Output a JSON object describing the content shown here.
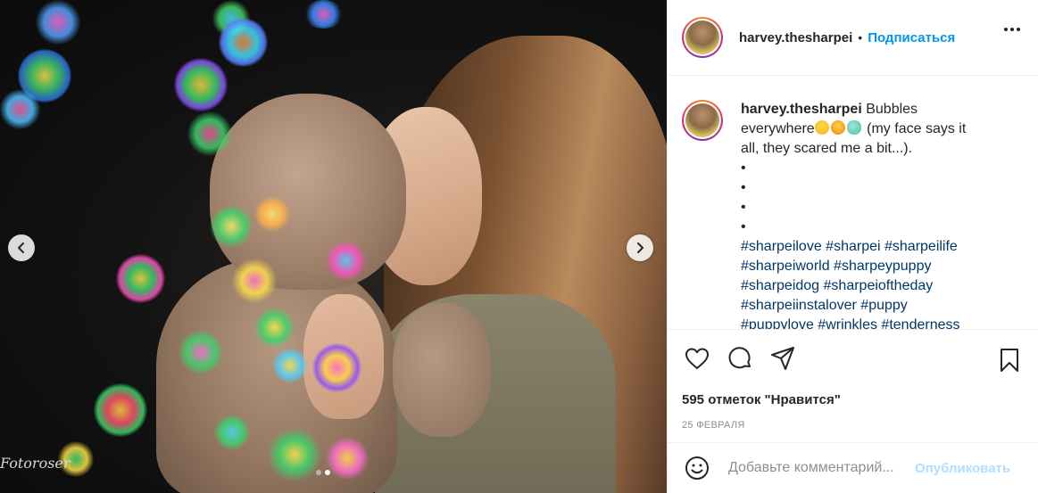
{
  "media": {
    "watermark": "Fotoroser",
    "slide_count": 2,
    "active_slide": 2
  },
  "header": {
    "username": "harvey.thesharpei",
    "separator": "•",
    "follow_label": "Подписаться"
  },
  "caption": {
    "username": "harvey.thesharpei",
    "text_line1": "Bubbles",
    "text_line2a": "everywhere",
    "text_line2b": " (my face says it",
    "text_line3": "all, they scared me a bit...).",
    "bullet": "•",
    "hashtags": [
      "#sharpeilove #sharpei #sharpeilife",
      "#sharpeiworld #sharpeypuppy",
      "#sharpeidog #sharpeioftheday",
      "#sharpeiinstalover #puppy",
      "#puppylove #wrinkles #tenderness"
    ],
    "emoji_icons": [
      "upside-down-face-emoji",
      "tongue-face-emoji",
      "cloud-emoji"
    ]
  },
  "actions": {
    "likes_text": "595 отметок \"Нравится\"",
    "date_text": "25 февраля"
  },
  "comment": {
    "placeholder": "Добавьте комментарий...",
    "publish_label": "Опубликовать"
  },
  "colors": {
    "accent": "#0095f6",
    "hashtag": "#00376b",
    "publish_disabled": "#b2dffc",
    "muted": "#8e8e8e"
  }
}
